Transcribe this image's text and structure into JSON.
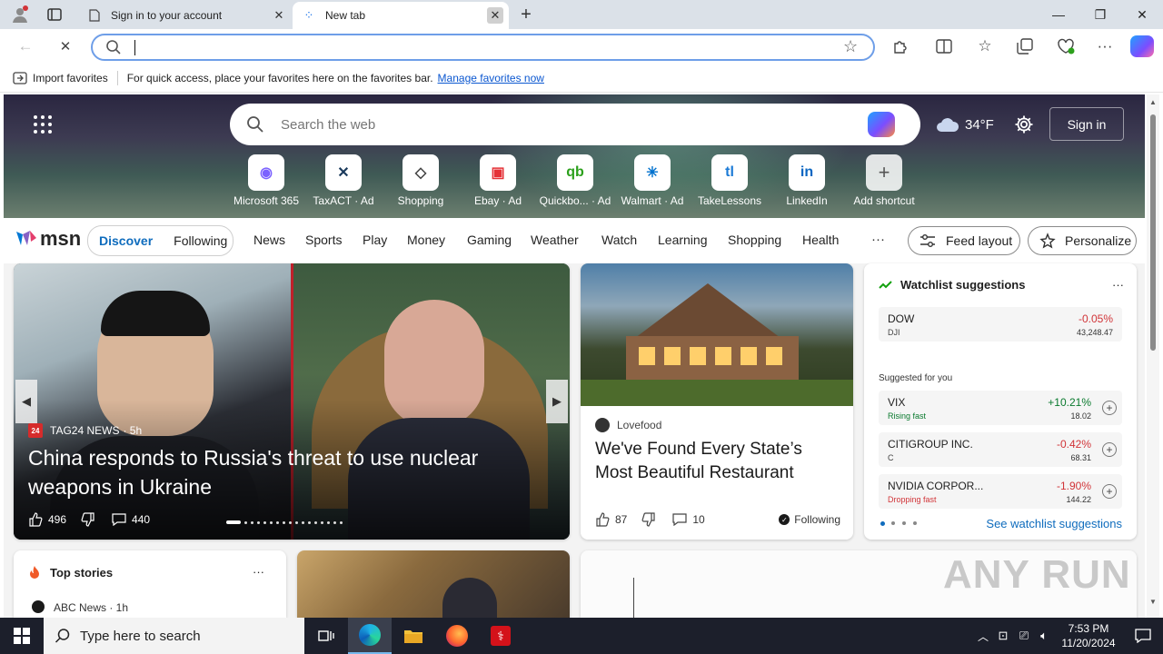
{
  "browser": {
    "tabs": [
      {
        "title": "Sign in to your account"
      },
      {
        "title": "New tab"
      }
    ],
    "favorites_bar": {
      "import_label": "Import favorites",
      "hint": "For quick access, place your favorites here on the favorites bar.",
      "manage_link": "Manage favorites now"
    }
  },
  "hero": {
    "search_placeholder": "Search the web",
    "weather_temp": "34°F",
    "sign_in_label": "Sign in",
    "shortcuts": [
      {
        "label": "Microsoft 365",
        "icon": "microsoft365-icon",
        "color": "#7b61ff"
      },
      {
        "label": "TaxACT · Ad",
        "icon": "taxact-icon",
        "color": "#1a3a5c"
      },
      {
        "label": "Shopping",
        "icon": "shopping-tag-icon",
        "color": "#444444"
      },
      {
        "label": "Ebay · Ad",
        "icon": "ebay-icon",
        "color": "#e53238"
      },
      {
        "label": "Quickbo... · Ad",
        "icon": "quickbooks-icon",
        "color": "#2ca01c"
      },
      {
        "label": "Walmart · Ad",
        "icon": "walmart-icon",
        "color": "#0071ce"
      },
      {
        "label": "TakeLessons",
        "icon": "takelessons-icon",
        "color": "#1b7ad6"
      },
      {
        "label": "LinkedIn",
        "icon": "linkedin-icon",
        "color": "#0a66c2"
      },
      {
        "label": "Add shortcut",
        "icon": "plus-icon",
        "color": "#555555"
      }
    ]
  },
  "msn": {
    "logo_text": "msn",
    "toggle": {
      "discover": "Discover",
      "following": "Following"
    },
    "nav": [
      "News",
      "Sports",
      "Play",
      "Money",
      "Gaming",
      "Weather",
      "Watch",
      "Learning",
      "Shopping",
      "Health"
    ],
    "more": "···",
    "feed_layout": "Feed layout",
    "personalize": "Personalize"
  },
  "main_story": {
    "source": "TAG24 NEWS",
    "age": "· 5h",
    "headline": "China responds to Russia's threat to use nuclear weapons in Ukraine",
    "likes": "496",
    "comments": "440"
  },
  "side_story": {
    "source": "Lovefood",
    "headline": "We've Found Every State’s Most Beautiful Restaurant",
    "likes": "87",
    "comments": "10",
    "following": "Following"
  },
  "watchlist": {
    "title": "Watchlist suggestions",
    "more": "···",
    "top": {
      "name": "DOW",
      "sub": "DJI",
      "change": "-0.05%",
      "price": "43,248.47"
    },
    "suggested_label": "Suggested for you",
    "items": [
      {
        "name": "VIX",
        "sub": "Rising fast",
        "change": "+10.21%",
        "price": "18.02",
        "color": "#0a7a2e"
      },
      {
        "name": "CITIGROUP INC.",
        "sub": "C",
        "change": "-0.42%",
        "price": "68.31",
        "color": "#d13438"
      },
      {
        "name": "NVIDIA CORPOR...",
        "sub": "Dropping fast",
        "change": "-1.90%",
        "price": "144.22",
        "color": "#d13438"
      }
    ],
    "see_more": "See watchlist suggestions"
  },
  "top_stories": {
    "title": "Top stories",
    "more": "···",
    "first_source": "ABC News · 1h"
  },
  "watermark": "ANY RUN",
  "taskbar": {
    "search_placeholder": "Type here to search",
    "time": "7:53 PM",
    "date": "11/20/2024"
  }
}
